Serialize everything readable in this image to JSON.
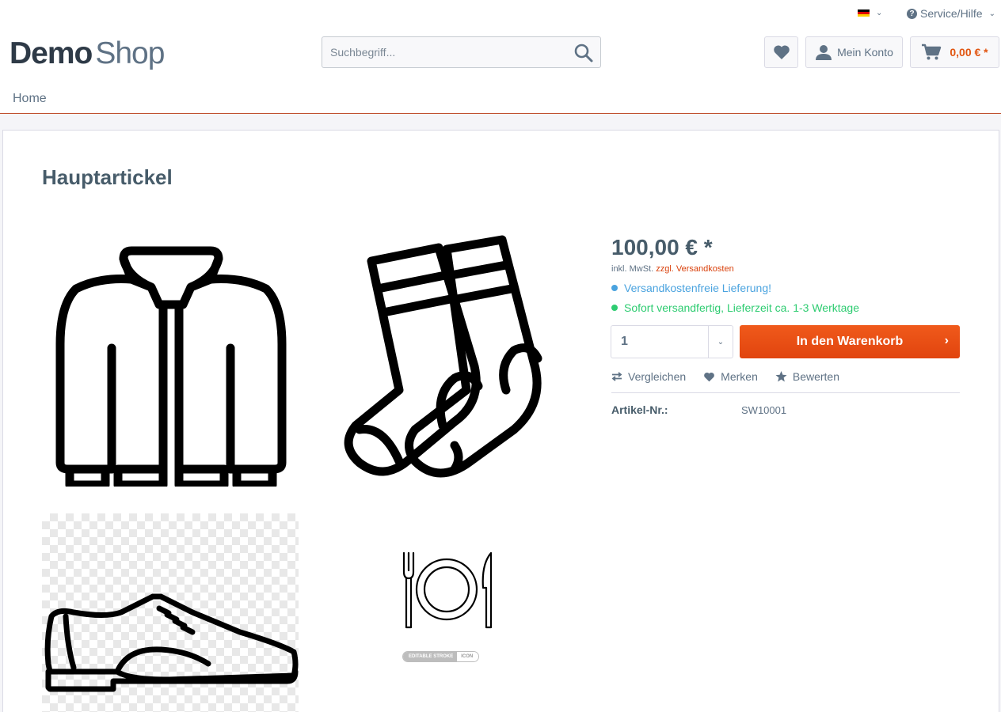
{
  "topbar": {
    "language_icon": "german-flag-icon",
    "service_label": "Service/Hilfe"
  },
  "header": {
    "logo_demo": "Demo",
    "logo_shop": "Shop",
    "search_placeholder": "Suchbegriff...",
    "account_label": "Mein Konto",
    "cart_total": "0,00 € *"
  },
  "nav": {
    "home": "Home"
  },
  "product": {
    "title": "Hauptartickel",
    "images": [
      "jacket-icon",
      "socks-icon",
      "shoe-icon",
      "plate-cutlery-icon"
    ],
    "badge_left": "EDITABLE STROKE",
    "badge_right": "ICON",
    "price": "100,00 € *",
    "tax_prefix": "inkl. MwSt.",
    "shipping_link": "zzgl. Versandkosten",
    "delivery_free": "Versandkostenfreie Lieferung!",
    "delivery_time": "Sofort versandfertig, Lieferzeit ca. 1-3 Werktage",
    "quantity": "1",
    "add_to_cart": "In den Warenkorb",
    "compare": "Vergleichen",
    "remember": "Merken",
    "rate": "Bewerten",
    "article_no_label": "Artikel-Nr.:",
    "article_no": "SW10001"
  },
  "colors": {
    "accent": "#e1540f",
    "text": "#5f7285",
    "heading": "#475c6a",
    "info_blue": "#4aa3df",
    "success_green": "#2ecc71"
  }
}
